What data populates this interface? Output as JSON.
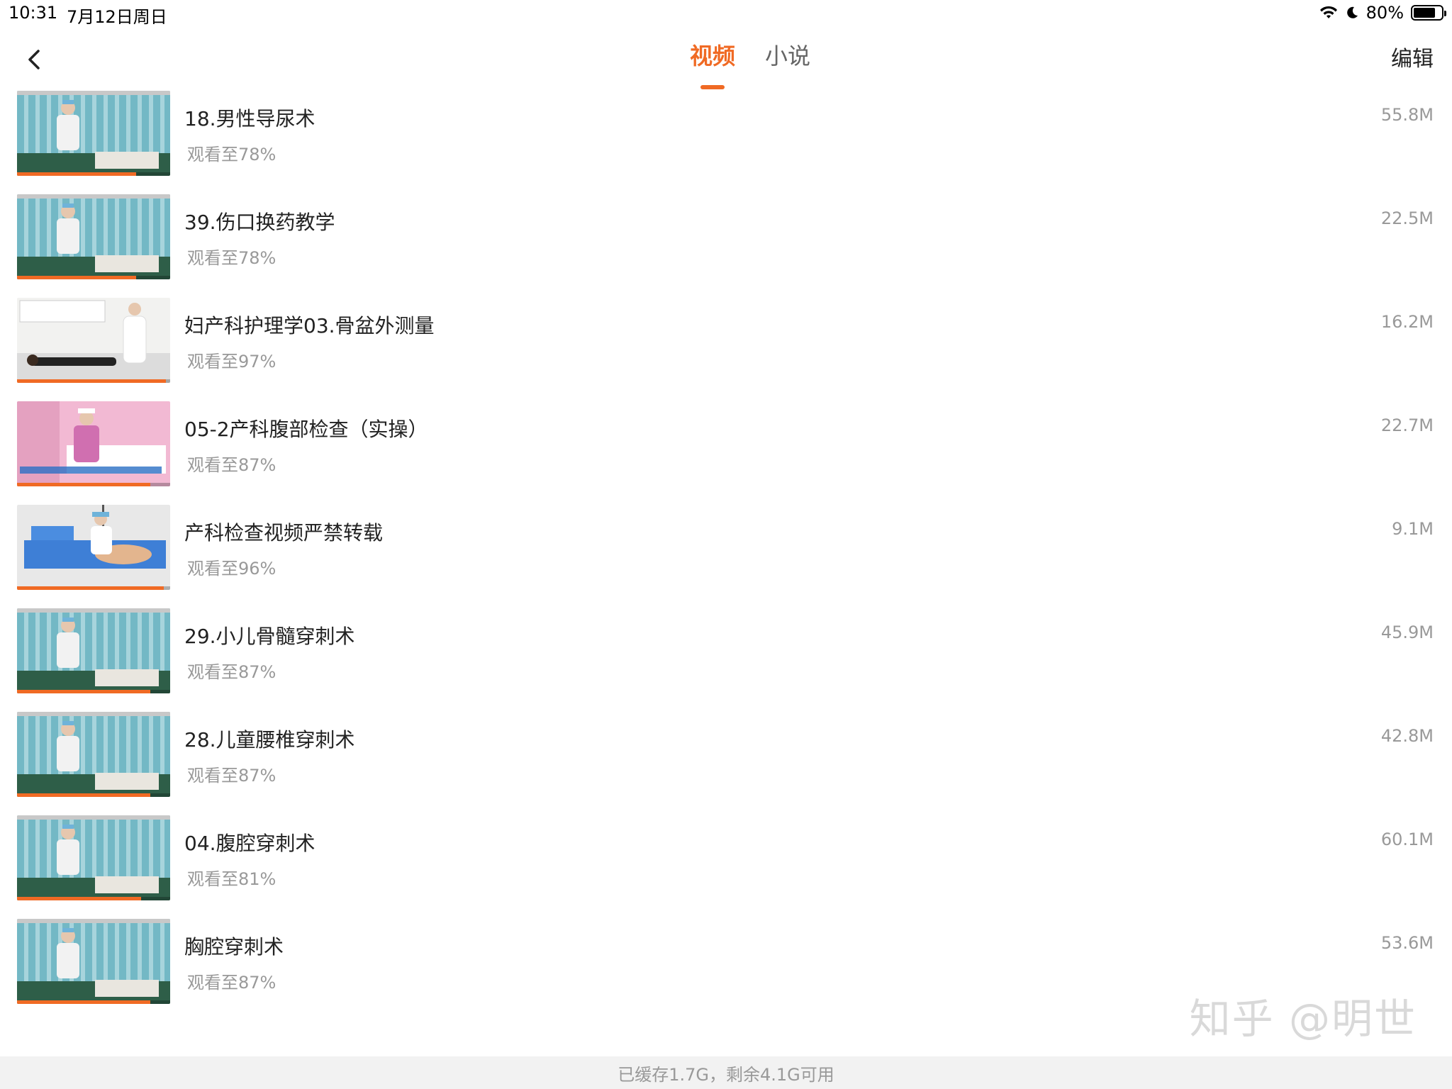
{
  "status": {
    "time": "10:31",
    "date": "7月12日周日",
    "battery": "80%",
    "battery_level": 0.8
  },
  "nav": {
    "tabs": [
      "视频",
      "小说"
    ],
    "active_tab": 0,
    "edit_label": "编辑"
  },
  "items": [
    {
      "title": "18.男性导尿术",
      "progress_text": "观看至78%",
      "progress": 0.78,
      "size": "55.8M",
      "thumb": "ward-blue"
    },
    {
      "title": "39.伤口换药教学",
      "progress_text": "观看至78%",
      "progress": 0.78,
      "size": "22.5M",
      "thumb": "ward-blue"
    },
    {
      "title": "妇产科护理学03.骨盆外测量",
      "progress_text": "观看至97%",
      "progress": 0.97,
      "size": "16.2M",
      "thumb": "white-room"
    },
    {
      "title": "05-2产科腹部检查（实操）",
      "progress_text": "观看至87%",
      "progress": 0.87,
      "size": "22.7M",
      "thumb": "pink-room"
    },
    {
      "title": "产科检查视频严禁转载",
      "progress_text": "观看至96%",
      "progress": 0.96,
      "size": "9.1M",
      "thumb": "exam-blue"
    },
    {
      "title": "29.小儿骨髓穿刺术",
      "progress_text": "观看至87%",
      "progress": 0.87,
      "size": "45.9M",
      "thumb": "ward-blue"
    },
    {
      "title": "28.儿童腰椎穿刺术",
      "progress_text": "观看至87%",
      "progress": 0.87,
      "size": "42.8M",
      "thumb": "ward-blue"
    },
    {
      "title": "04.腹腔穿刺术",
      "progress_text": "观看至81%",
      "progress": 0.81,
      "size": "60.1M",
      "thumb": "ward-blue"
    },
    {
      "title": "胸腔穿刺术",
      "progress_text": "观看至87%",
      "progress": 0.87,
      "size": "53.6M",
      "thumb": "ward-blue"
    }
  ],
  "footer": {
    "text": "已缓存1.7G，剩余4.1G可用"
  },
  "watermark": "知乎 @明世",
  "colors": {
    "accent": "#f06a24",
    "secondary_text": "#999999"
  }
}
